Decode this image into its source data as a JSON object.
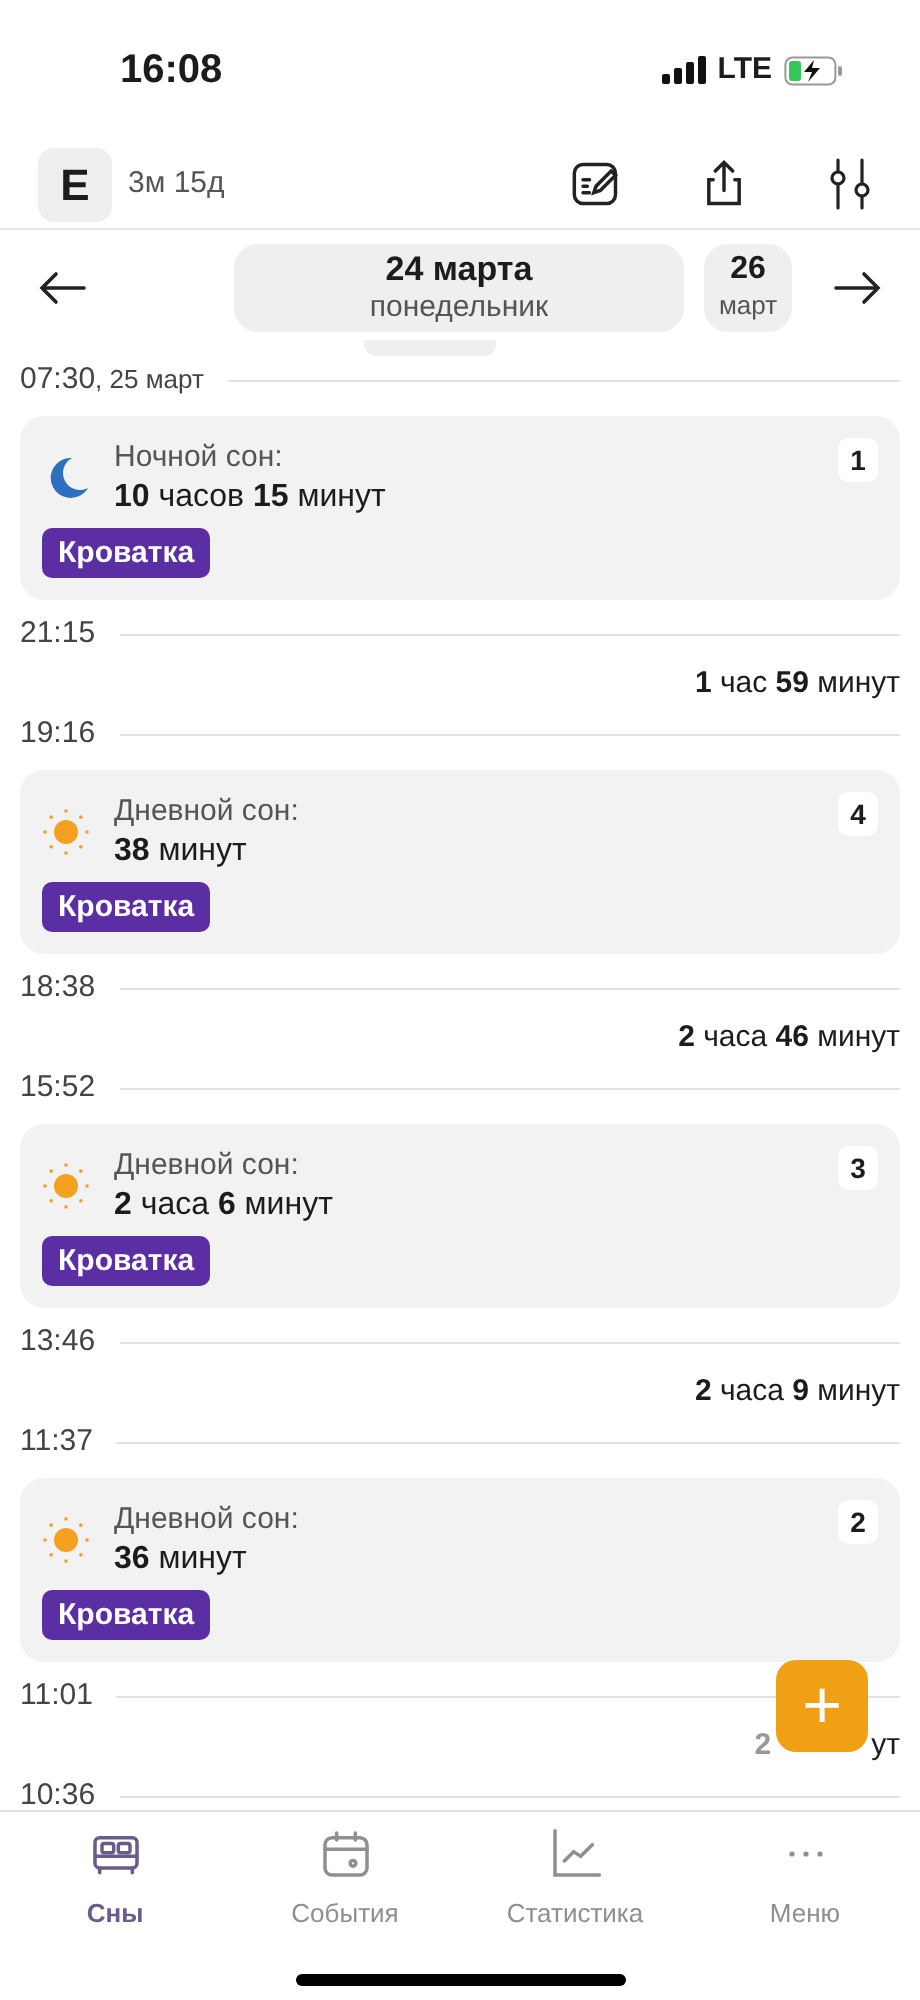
{
  "status_bar": {
    "time": "16:08",
    "network": "LTE"
  },
  "header": {
    "avatar_letter": "E",
    "age": "3м 15д"
  },
  "date_nav": {
    "current_date": "24 марта",
    "current_weekday": "понедельник",
    "next_day": "26",
    "next_month": "март"
  },
  "timeline": [
    {
      "kind": "time",
      "time": "07:30",
      "suffix": ", 25 март"
    },
    {
      "kind": "night_sleep",
      "label": "Ночной сон:",
      "duration": "**10** часов **15** минут",
      "tag": "Кроватка",
      "number": "1"
    },
    {
      "kind": "time",
      "time": "21:15"
    },
    {
      "kind": "gap",
      "text": "**1** час **59** минут"
    },
    {
      "kind": "time",
      "time": "19:16"
    },
    {
      "kind": "day_sleep",
      "label": "Дневной сон:",
      "duration": "**38** минут",
      "tag": "Кроватка",
      "number": "4"
    },
    {
      "kind": "time",
      "time": "18:38"
    },
    {
      "kind": "gap",
      "text": "**2** часа **46** минут"
    },
    {
      "kind": "time",
      "time": "15:52"
    },
    {
      "kind": "day_sleep",
      "label": "Дневной сон:",
      "duration": "**2** часа **6** минут",
      "tag": "Кроватка",
      "number": "3"
    },
    {
      "kind": "time",
      "time": "13:46"
    },
    {
      "kind": "gap",
      "text": "**2** часа **9** минут"
    },
    {
      "kind": "time",
      "time": "11:37"
    },
    {
      "kind": "day_sleep",
      "label": "Дневной сон:",
      "duration": "**36** минут",
      "tag": "Кроватка",
      "number": "2"
    },
    {
      "kind": "time",
      "time": "11:01"
    },
    {
      "kind": "covered_gap",
      "start": "2",
      "end": "ут"
    },
    {
      "kind": "time",
      "time": "10:36"
    }
  ],
  "fab": {
    "symbol": "+"
  },
  "tabs": [
    {
      "label": "Сны",
      "selected": true
    },
    {
      "label": "События",
      "selected": false
    },
    {
      "label": "Статистика",
      "selected": false
    },
    {
      "label": "Меню",
      "selected": false
    }
  ]
}
